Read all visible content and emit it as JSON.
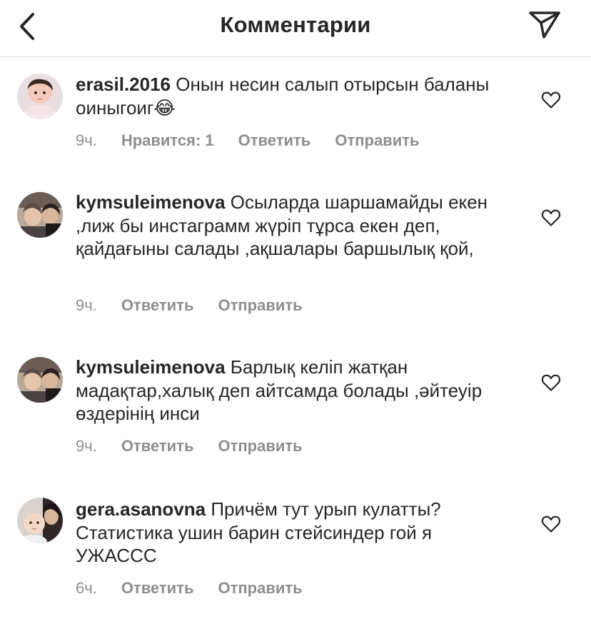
{
  "header": {
    "title": "Комментарии",
    "back_icon": "chevron-left-icon",
    "send_icon": "paper-plane-icon"
  },
  "comments": [
    {
      "username": "erasil.2016",
      "text": "Онын несин салып отырсын баланы оиныгоиг😂",
      "time": "9ч.",
      "likes": "Нравится: 1",
      "reply": "Ответить",
      "send": "Отправить"
    },
    {
      "username": "kymsuleimenova",
      "text": "Осыларда шаршамайды екен ,лиж бы инстаграмм жүріп тұрса екен деп, қайдағыны салады ,ақшалары баршылық қой,",
      "time": "9ч.",
      "reply": "Ответить",
      "send": "Отправить"
    },
    {
      "username": "kymsuleimenova",
      "text": "Барлық келіп жатқан мадақтар,халық деп айтсамда болады ,әйтеуір өздерінің инси",
      "time": "9ч.",
      "reply": "Ответить",
      "send": "Отправить"
    },
    {
      "username": "gera.asanovna",
      "text": "Причём тут урып кулатты? Статистика ушин барин стейсиндер гой я УЖАССС",
      "time": "6ч.",
      "reply": "Ответить",
      "send": "Отправить"
    }
  ],
  "colors": {
    "text": "#262626",
    "secondary": "#8e8e8e",
    "divider": "#dbdbdb"
  }
}
